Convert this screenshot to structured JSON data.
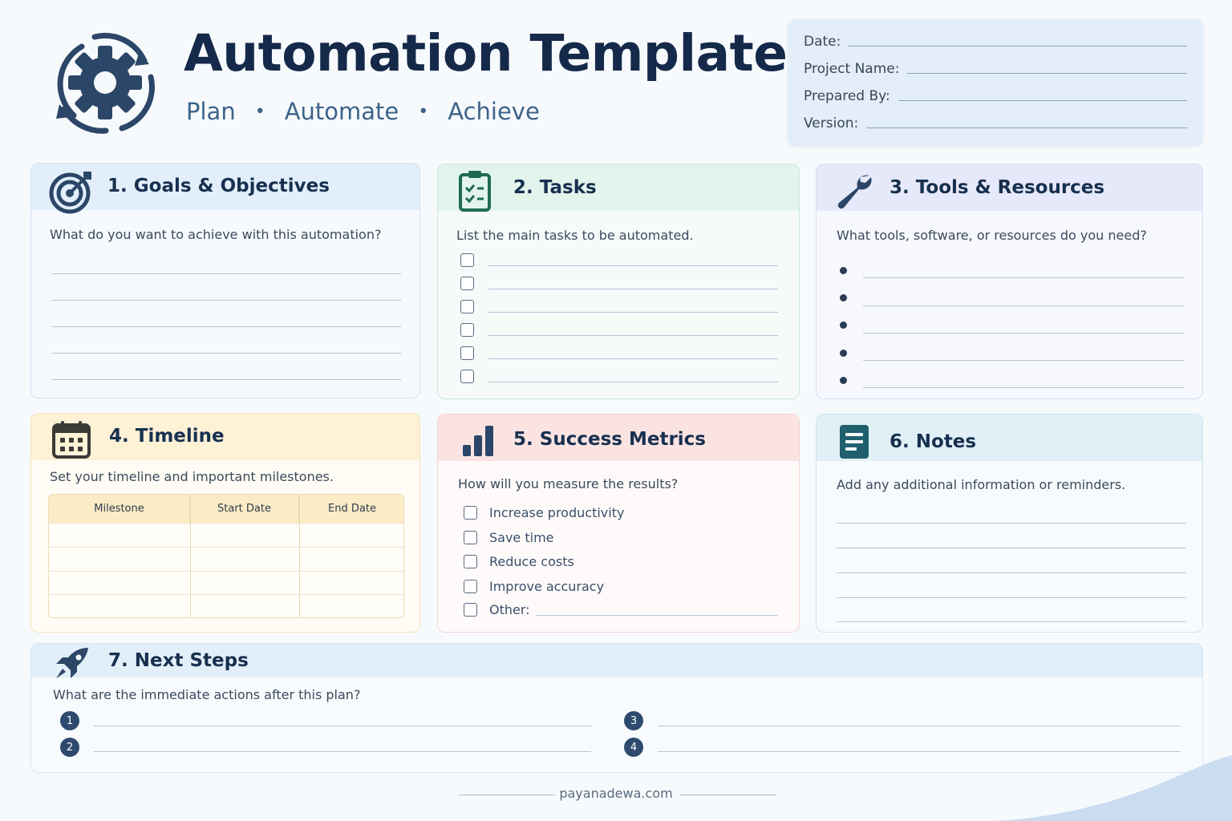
{
  "header": {
    "title": "Automation Template",
    "tagline": [
      "Plan",
      "Automate",
      "Achieve"
    ],
    "tagline_separator": "•"
  },
  "info_fields": [
    "Date:",
    "Project Name:",
    "Prepared By:",
    "Version:"
  ],
  "sections": {
    "goals": {
      "number": "1.",
      "title": "Goals & Objectives",
      "icon": "target-icon",
      "prompt": "What do you want to achieve with this automation?"
    },
    "tasks": {
      "number": "2.",
      "title": "Tasks",
      "icon": "clipboard-checklist-icon",
      "prompt": "List the main tasks to be automated."
    },
    "tools": {
      "number": "3.",
      "title": "Tools & Resources",
      "icon": "wrench-icon",
      "prompt": "What tools, software, or resources do you need?"
    },
    "timeline": {
      "number": "4.",
      "title": "Timeline",
      "icon": "calendar-icon",
      "prompt": "Set your timeline and important milestones.",
      "columns": [
        "Milestone",
        "Start Date",
        "End Date"
      ]
    },
    "metrics": {
      "number": "5.",
      "title": "Success Metrics",
      "icon": "bar-chart-icon",
      "prompt": "How will you measure the results?",
      "options": [
        "Increase productivity",
        "Save time",
        "Reduce costs",
        "Improve accuracy",
        "Other:"
      ]
    },
    "notes": {
      "number": "6.",
      "title": "Notes",
      "icon": "document-icon",
      "prompt": "Add any additional information or reminders."
    },
    "next": {
      "number": "7.",
      "title": "Next Steps",
      "icon": "rocket-icon",
      "prompt": "What are the immediate actions after this plan?",
      "steps": [
        "1",
        "2",
        "3",
        "4"
      ]
    }
  },
  "footer": {
    "text": "payanadewa.com"
  },
  "colors": {
    "title": "#15294a",
    "accent": "#3d6388",
    "goals_head": "#e2effb",
    "tasks_head": "#e2f4ec",
    "tools_head": "#e6e9f9",
    "timeline_head": "#fdf1d6",
    "metrics_head": "#fbe3e2",
    "notes_head": "#e1f0f6",
    "next_head": "#e2eff9"
  }
}
